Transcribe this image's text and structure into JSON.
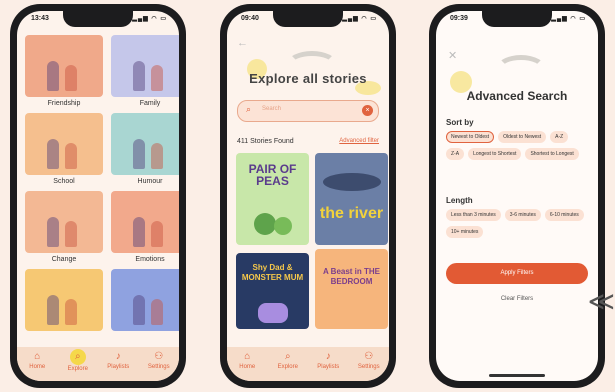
{
  "colors": {
    "accent": "#e0633f",
    "background": "#fbeee6",
    "phone_frame": "#1c1c1e",
    "tab_bar": "#f6dcc9",
    "apply_button": "#e25a34"
  },
  "phone1": {
    "time": "13:43",
    "categories": [
      {
        "label": "Friendship",
        "color": "#f0a98a"
      },
      {
        "label": "Family",
        "color": "#c5c7ea"
      },
      {
        "label": "School",
        "color": "#f5bf8e"
      },
      {
        "label": "Humour",
        "color": "#a9d6d2"
      },
      {
        "label": "Change",
        "color": "#f3b894"
      },
      {
        "label": "Emotions",
        "color": "#f2a98c"
      },
      {
        "label": "",
        "color": "#f6c873"
      },
      {
        "label": "",
        "color": "#8fa2e0"
      }
    ]
  },
  "tabs": [
    {
      "label": "Home",
      "icon": "home-icon",
      "glyph": "⌂"
    },
    {
      "label": "Explore",
      "icon": "search-icon",
      "glyph": "⌕"
    },
    {
      "label": "Playlists",
      "icon": "music-note-icon",
      "glyph": "♪"
    },
    {
      "label": "Settings",
      "icon": "person-icon",
      "glyph": "⚇"
    }
  ],
  "phone2": {
    "time": "09:40",
    "title": "Explore all stories",
    "search_placeholder": "Search",
    "stories_found": "411 Stories Found",
    "advanced_filter": "Advanced filter",
    "books": [
      {
        "title": "PAIR OF PEAS",
        "color": "#c8e7a9",
        "text_color": "#5a3b8c"
      },
      {
        "title": "the river",
        "color": "#6b7fa6",
        "text_color": "#f3d23b"
      },
      {
        "title": "Shy Dad & MONSTER MUM",
        "color": "#283a64",
        "text_color": "#f6c84a"
      },
      {
        "title": "A Beast in THE BEDROOM",
        "color": "#f6b57c",
        "text_color": "#7b3e8c"
      }
    ]
  },
  "phone3": {
    "time": "09:39",
    "title": "Advanced Search",
    "sort_by_label": "Sort by",
    "sort_options": [
      "Newest to Oldest",
      "Oldest to Newest",
      "A-Z",
      "Z-A",
      "Longest to Shortest",
      "Shortest to Longest"
    ],
    "sort_selected": "Newest to Oldest",
    "length_label": "Length",
    "length_options": [
      "Less than 3 minutes",
      "3-6 minutes",
      "6-10 minutes",
      "10+ minutes"
    ],
    "apply_label": "Apply Filters",
    "clear_label": "Clear Filters"
  }
}
